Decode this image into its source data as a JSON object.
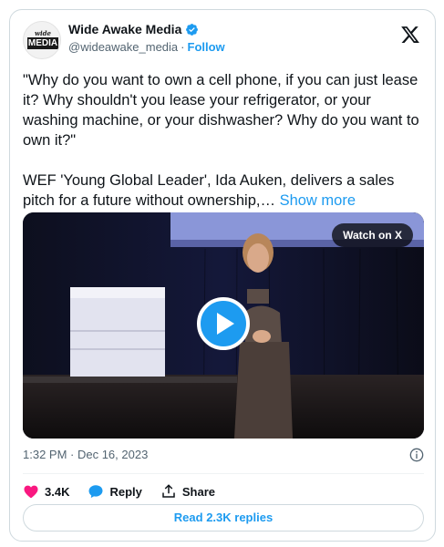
{
  "header": {
    "avatar_logo_top": "wide awake",
    "avatar_logo_bottom": "MEDIA",
    "display_name": "Wide Awake Media",
    "handle": "@wideawake_media",
    "separator": "·",
    "follow_label": "Follow"
  },
  "tweet": {
    "quote": "\"Why do you want to own a cell phone, if you can just lease it? Why shouldn't you lease your refrigerator, or your washing machine, or your dishwasher? Why do you want to own it?\"",
    "body": "WEF 'Young Global Leader', Ida Auken, delivers a sales pitch for a future without ownership,…",
    "show_more": "Show more"
  },
  "media": {
    "watch_label": "Watch on X"
  },
  "meta": {
    "timestamp": "1:32 PM · Dec 16, 2023"
  },
  "actions": {
    "likes": "3.4K",
    "reply_label": "Reply",
    "share_label": "Share"
  },
  "footer": {
    "read_replies": "Read 2.3K replies"
  },
  "colors": {
    "accent": "#1d9bf0",
    "like": "#f91880",
    "muted": "#536471"
  }
}
